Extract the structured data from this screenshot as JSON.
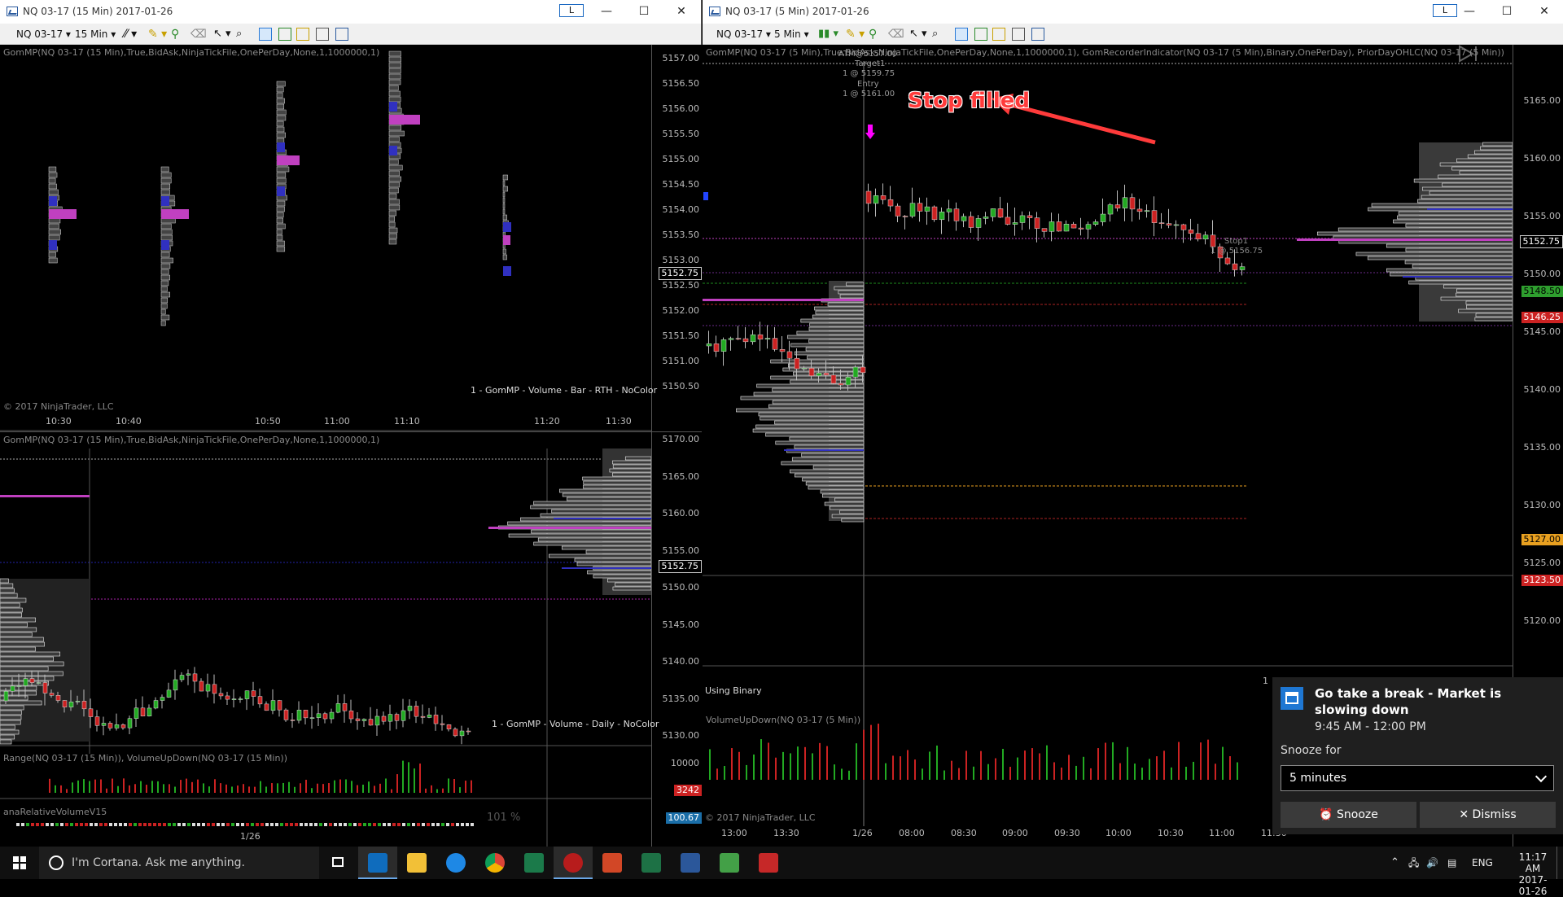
{
  "left_window": {
    "title": "NQ 03-17 (15 Min)  2017-01-26",
    "link_button": "L",
    "controls": [
      "—",
      "☐",
      "✕"
    ],
    "toolbar": {
      "instrument": "NQ 03-17",
      "interval": "15 Min"
    }
  },
  "right_window": {
    "title": "NQ 03-17 (5 Min)  2017-01-26",
    "link_button": "L",
    "controls": [
      "—",
      "☐",
      "✕"
    ],
    "toolbar": {
      "instrument": "NQ 03-17",
      "interval": "5 Min"
    }
  },
  "left_top_pane": {
    "header": "GomMP(NQ 03-17 (15 Min),True,BidAsk,NinjaTickFile,OnePerDay,None,1,1000000,1)",
    "price_labels": [
      "5157.00",
      "5156.50",
      "5156.00",
      "5155.50",
      "5155.00",
      "5154.50",
      "5154.00",
      "5153.50",
      "5153.00",
      "5152.50",
      "5152.00",
      "5151.50",
      "5151.00",
      "5150.50"
    ],
    "current_price": "5152.75",
    "indicator_label": "1 - GomMP  - Volume - Bar - RTH - NoColor",
    "copyright": "© 2017 NinjaTrader, LLC",
    "time_labels": [
      "10:30",
      "10:40",
      "10:50",
      "11:00",
      "11:10",
      "11:20",
      "11:30"
    ]
  },
  "left_bottom_pane": {
    "header": "GomMP(NQ 03-17 (15 Min),True,BidAsk,NinjaTickFile,OnePerDay,None,1,1000000,1)",
    "price_labels": [
      "5170.00",
      "5165.00",
      "5160.00",
      "5155.00",
      "5150.00",
      "5145.00",
      "5140.00",
      "5135.00",
      "5130.00"
    ],
    "current_price": "5152.75",
    "indicator_label": "1 - GomMP  - Volume - Daily - NoColor",
    "range_header": "Range(NQ 03-17 (15 Min)), VolumeUpDown(NQ 03-17 (15 Min))",
    "range_axis": "10000",
    "range_value": "3242",
    "rel_header": "anaRelativeVolumeV15",
    "rel_percent": "101 %",
    "rel_value": "100.67",
    "date_label": "1/26"
  },
  "right_main_pane": {
    "header": "GomMP(NQ 03-17 (5 Min),True,BidAsk,NinjaTickFile,OnePerDay,None,1,1000000,1), GomRecorderIndicator(NQ 03-17 (5 Min),Binary,OnePerDay), PriorDayOHLC(NQ 03-17 (5 Min))",
    "order_label_1": "ATM@5157.00",
    "order_label_2": "Target1",
    "order_label_3": "1 @ 5159.75",
    "order_label_4": "Entry",
    "order_label_5": "1 @ 5161.00",
    "stop_label_1": "Stop1",
    "stop_label_2": "1 @ 5156.75",
    "annotation": "Stop filled",
    "price_labels": [
      "5165.00",
      "5160.00",
      "5155.00",
      "5150.00",
      "5145.00",
      "5140.00",
      "5135.00",
      "5130.00",
      "5125.00",
      "5120.00"
    ],
    "current_price": "5152.75",
    "level_green": "5148.50",
    "level_red_upper": "5146.25",
    "level_orange": "5127.00",
    "level_red_lower": "5123.50",
    "recorder_label": "Using Binary",
    "volume_header": "VolumeUpDown(NQ 03-17 (5 Min))",
    "copyright": "© 2017 NinjaTrader, LLC",
    "time_labels": [
      "13:00",
      "13:30",
      "1/26",
      "08:00",
      "08:30",
      "09:00",
      "09:30",
      "10:00",
      "10:30",
      "11:00",
      "11:30"
    ],
    "time_labels_hidden": "1"
  },
  "notification": {
    "title": "Go take a break - Market is slowing down",
    "time_range": "9:45 AM - 12:00 PM",
    "snooze_label": "Snooze for",
    "snooze_value": "5 minutes",
    "snooze_button": "Snooze",
    "dismiss_button": "Dismiss"
  },
  "taskbar": {
    "search_text": "I'm Cortana. Ask me anything.",
    "language": "ENG",
    "time": "11:17 AM",
    "date": "2017-01-26"
  },
  "colors": {
    "up_candle": "#22aa22",
    "down_candle": "#cc2222",
    "poc": "#c040c0",
    "value_area": "#3030c0",
    "annotation": "#ff3333"
  }
}
